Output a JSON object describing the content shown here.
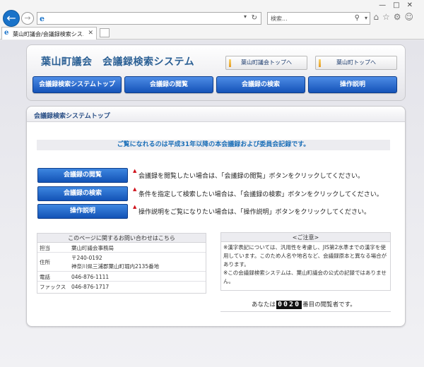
{
  "browser": {
    "search_placeholder": "検索...",
    "tab_title": "葉山町議会/会議録検索シス..."
  },
  "header": {
    "site_title": "葉山町議会　会議録検索システム",
    "link_assembly": "葉山町議会トップへ",
    "link_town": "葉山町トップへ"
  },
  "mainnav": {
    "items": [
      "会議録検索システムトップ",
      "会議録の閲覧",
      "会議録の検索",
      "操作説明"
    ]
  },
  "content": {
    "title": "会議録検索システムトップ",
    "notice": "ご覧になれるのは平成31年以降の本会議録および委員会記録です。",
    "features": [
      {
        "button": "会議録の閲覧",
        "mark": "▲",
        "desc": "会議録を閲覧したい場合は、「会議録の閲覧」ボタンをクリックしてください。"
      },
      {
        "button": "会議録の検索",
        "mark": "▲",
        "desc": "条件を指定して検索したい場合は、「会議録の検索」ボタンをクリックしてください。"
      },
      {
        "button": "操作説明",
        "mark": "▲",
        "desc": "操作説明をご覧になりたい場合は、「操作説明」ボタンをクリックしてください。"
      }
    ]
  },
  "contact": {
    "heading": "このページに関するお問い合わせはこちら",
    "rows": [
      {
        "label": "担当",
        "value": "葉山町議会事務局"
      },
      {
        "label": "住所",
        "value_line1": "〒240-0192",
        "value_line2": "神奈川県三浦郡葉山町堀内2135番地"
      },
      {
        "label": "電話",
        "value": "046-876-1111"
      },
      {
        "label": "ファックス",
        "value": "046-876-1717"
      }
    ]
  },
  "caution": {
    "heading": "<ご注意>",
    "text1": "※漢字表記については、汎用性を考慮し、JIS第2水準までの漢字を使用しています。このため人名や地名など、会議録原本と異なる場合があります。",
    "text2": "※この会議録検索システムは、葉山町議会の公式の記録ではありません。"
  },
  "counter": {
    "prefix": "あなたは",
    "digits": "0020",
    "suffix": "番目の閲覧者です。"
  }
}
